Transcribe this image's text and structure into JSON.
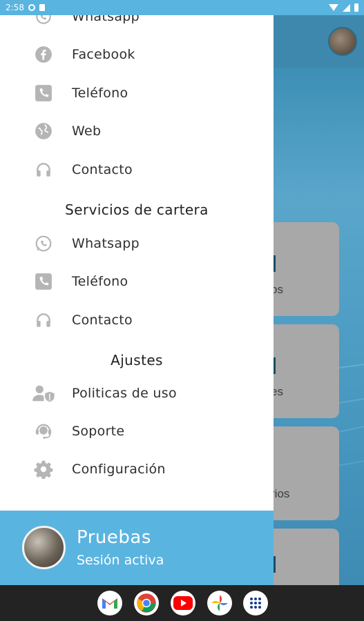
{
  "status_bar": {
    "time": "2:58"
  },
  "drawer": {
    "top_partial_item": {
      "label": "Whatsapp",
      "icon": "whatsapp-icon"
    },
    "contact_items": [
      {
        "label": "Facebook",
        "icon": "facebook-icon"
      },
      {
        "label": "Teléfono",
        "icon": "phone-icon"
      },
      {
        "label": "Web",
        "icon": "globe-icon"
      },
      {
        "label": "Contacto",
        "icon": "headset-icon"
      }
    ],
    "portfolio_section": {
      "title": "Servicios de cartera",
      "items": [
        {
          "label": "Whatsapp",
          "icon": "whatsapp-icon"
        },
        {
          "label": "Teléfono",
          "icon": "phone-icon"
        },
        {
          "label": "Contacto",
          "icon": "headset-icon"
        }
      ]
    },
    "settings_section": {
      "title": "Ajustes",
      "items": [
        {
          "label": "Politicas de uso",
          "icon": "user-shield-icon"
        },
        {
          "label": "Soporte",
          "icon": "support-agent-icon"
        },
        {
          "label": "Configuración",
          "icon": "gear-icon"
        }
      ]
    },
    "footer": {
      "name": "Pruebas",
      "status": "Sesión activa"
    }
  },
  "background_app": {
    "card_labels": [
      "os",
      "es",
      "rios"
    ]
  },
  "dock": {
    "apps": [
      {
        "name": "Gmail",
        "icon": "gmail-icon",
        "color": "#EA4335"
      },
      {
        "name": "Chrome",
        "icon": "chrome-icon",
        "color": "#4285F4"
      },
      {
        "name": "YouTube",
        "icon": "youtube-icon",
        "color": "#FF0000"
      },
      {
        "name": "Photos",
        "icon": "photos-icon",
        "color": "#FBBC05"
      },
      {
        "name": "App drawer",
        "icon": "apps-icon",
        "color": "#1A3C8C"
      }
    ]
  },
  "colors": {
    "accent": "#5ab4e0",
    "icon_gray": "#b5b5b5",
    "text": "#2f2f2f"
  }
}
